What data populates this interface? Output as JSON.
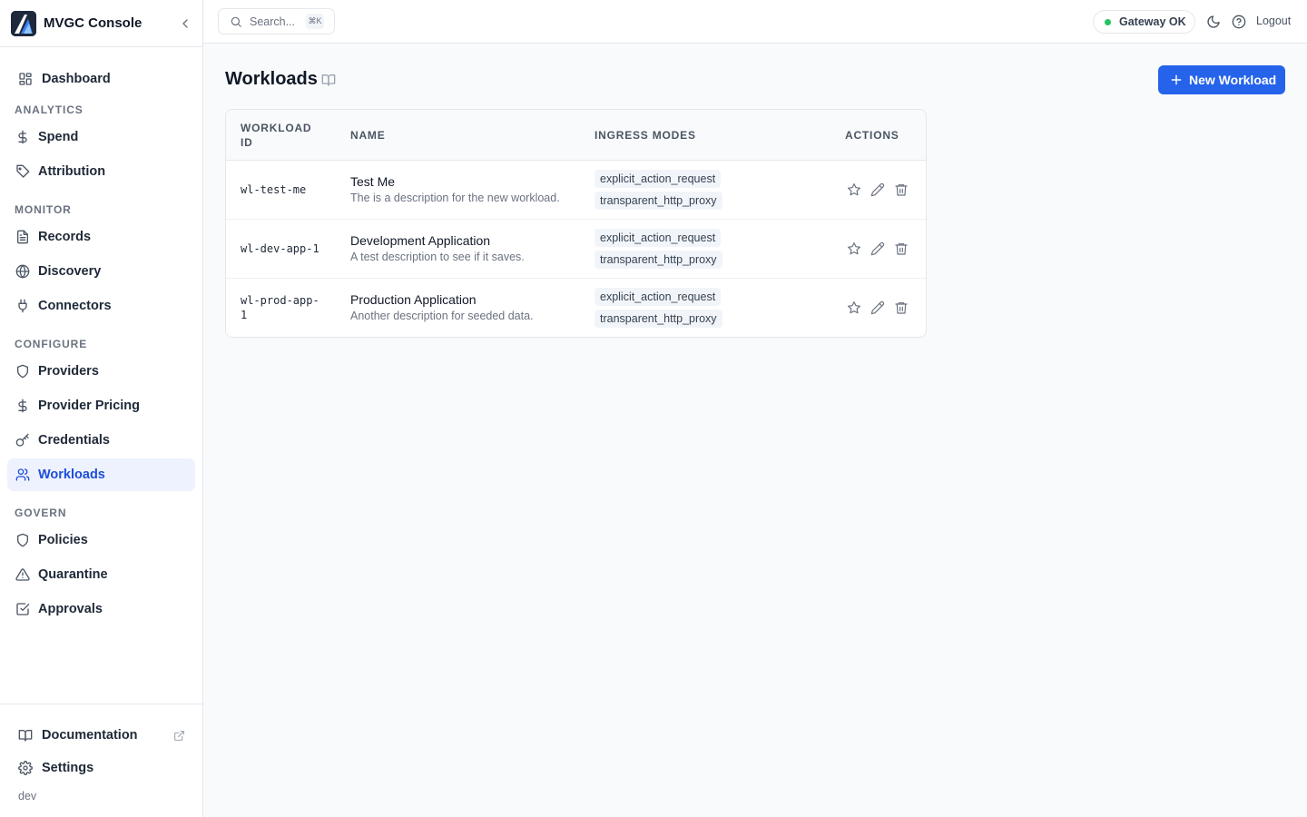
{
  "app": {
    "title": "MVGC Console"
  },
  "sidebar": {
    "dashboard": "Dashboard",
    "sections": {
      "analytics": "ANALYTICS",
      "monitor": "MONITOR",
      "configure": "CONFIGURE",
      "govern": "GOVERN"
    },
    "items": {
      "spend": "Spend",
      "attribution": "Attribution",
      "records": "Records",
      "discovery": "Discovery",
      "connectors": "Connectors",
      "providers": "Providers",
      "provider_pricing": "Provider Pricing",
      "credentials": "Credentials",
      "workloads": "Workloads",
      "policies": "Policies",
      "quarantine": "Quarantine",
      "approvals": "Approvals"
    },
    "active": "workloads",
    "footer": {
      "documentation": "Documentation",
      "settings": "Settings",
      "env": "dev"
    }
  },
  "topbar": {
    "search_placeholder": "Search...",
    "search_shortcut": "⌘K",
    "gateway_status": "Gateway OK",
    "logout": "Logout"
  },
  "page": {
    "title": "Workloads",
    "new_button": "New Workload"
  },
  "table": {
    "columns": {
      "id_line1": "WORKLOAD",
      "id_line2": "ID",
      "name": "NAME",
      "ingress": "INGRESS MODES",
      "actions": "ACTIONS"
    },
    "rows": [
      {
        "id_line1": "wl-test-me",
        "id_line2": "",
        "name": "Test Me",
        "description": "The is a description for the new workload.",
        "modes": [
          "explicit_action_request",
          "transparent_http_proxy"
        ]
      },
      {
        "id_line1": "wl-dev-app-1",
        "id_line2": "",
        "name": "Development Application",
        "description": "A test description to see if it saves.",
        "modes": [
          "explicit_action_request",
          "transparent_http_proxy"
        ]
      },
      {
        "id_line1": "wl-prod-app-",
        "id_line2": "1",
        "name": "Production Application",
        "description": "Another description for seeded data.",
        "modes": [
          "explicit_action_request",
          "transparent_http_proxy"
        ]
      }
    ]
  },
  "colors": {
    "accent": "#2563eb",
    "active_nav_bg": "#eef2ff",
    "active_nav_text": "#1d4ed8",
    "status_ok": "#22c55e"
  },
  "icons": {
    "brand": "mvgc-logo-icon",
    "collapse": "chevron-left-icon",
    "dashboard": "layout-grid-icon",
    "spend": "dollar-icon",
    "attribution": "tag-icon",
    "records": "file-text-icon",
    "discovery": "globe-icon",
    "connectors": "plug-icon",
    "providers": "shield-icon",
    "provider_pricing": "dollar-icon",
    "credentials": "key-icon",
    "workloads": "users-icon",
    "policies": "shield-icon",
    "quarantine": "alert-triangle-icon",
    "approvals": "check-square-icon",
    "documentation": "book-open-icon",
    "external": "external-link-icon",
    "settings": "gear-icon",
    "search": "search-icon",
    "theme": "moon-icon",
    "help": "help-circle-icon",
    "add": "plus-icon",
    "favorite": "star-icon",
    "edit": "pencil-icon",
    "delete": "trash-icon"
  }
}
